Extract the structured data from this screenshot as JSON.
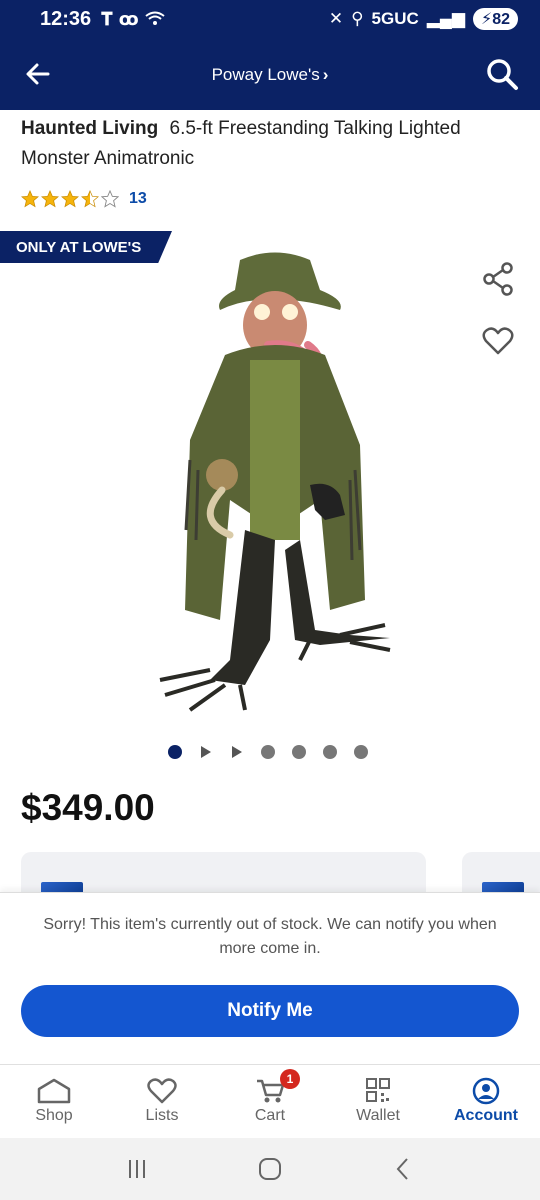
{
  "status_bar": {
    "time": "12:36",
    "network": "5GUC",
    "battery": "82"
  },
  "header": {
    "store_name": "Poway Lowe's",
    "chevron": "›"
  },
  "product": {
    "brand": "Haunted Living",
    "name": "6.5-ft Freestanding Talking Lighted Monster Animatronic",
    "rating": 3.5,
    "review_count": "13",
    "badge": "ONLY AT LOWE'S",
    "price": "$349.00",
    "image_count": 7,
    "active_image": 1
  },
  "stock": {
    "message": "Sorry! This item's currently out of stock. We can notify you when more come in.",
    "notify_label": "Notify Me"
  },
  "bottom_nav": {
    "items": [
      {
        "label": "Shop",
        "icon": "home-icon"
      },
      {
        "label": "Lists",
        "icon": "heart-icon"
      },
      {
        "label": "Cart",
        "icon": "cart-icon",
        "badge": "1"
      },
      {
        "label": "Wallet",
        "icon": "qr-code-icon"
      },
      {
        "label": "Account",
        "icon": "account-icon",
        "active": true
      }
    ]
  },
  "colors": {
    "navy": "#0b2265",
    "accent_blue": "#1456d0",
    "link_blue": "#0c4ba8",
    "star_gold": "#f5b40c",
    "badge_red": "#d4281f"
  }
}
